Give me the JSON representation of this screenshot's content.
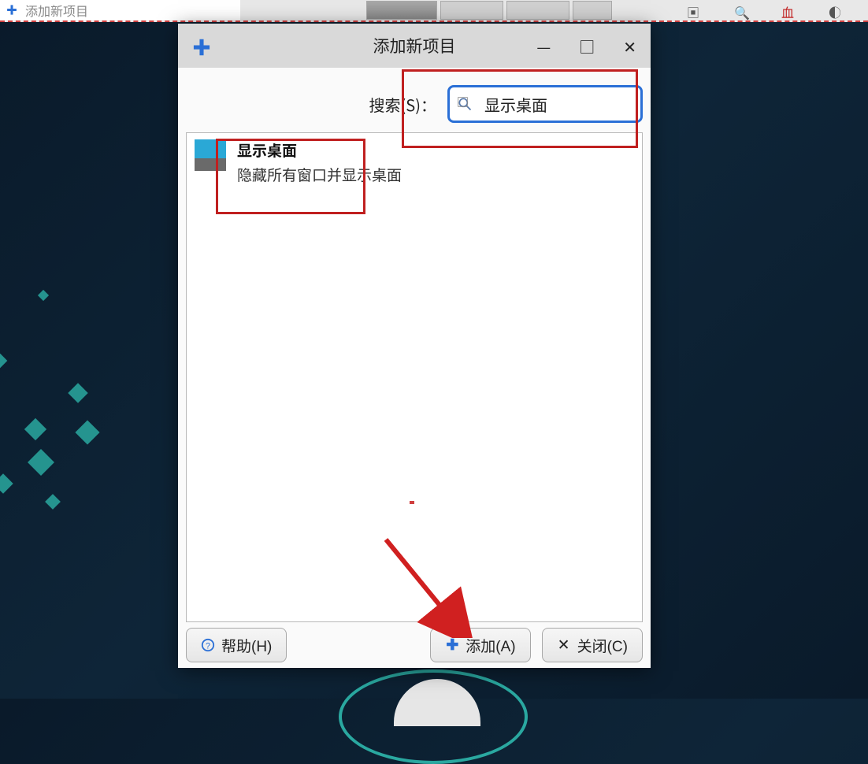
{
  "taskbar": {
    "title": "添加新项目"
  },
  "dialog": {
    "title": "添加新项目",
    "search": {
      "label": "搜索(S)：",
      "value": "显示桌面"
    },
    "results": [
      {
        "title": "显示桌面",
        "description": "隐藏所有窗口并显示桌面"
      }
    ],
    "buttons": {
      "help": "帮助(H)",
      "add": "添加(A)",
      "close": "关闭(C)"
    }
  }
}
